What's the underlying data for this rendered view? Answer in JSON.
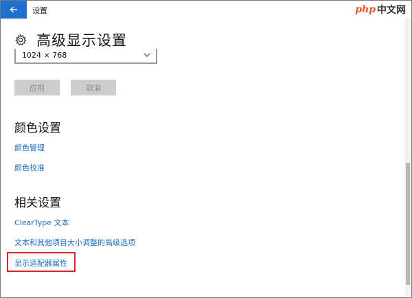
{
  "window": {
    "title": "设置",
    "watermark": {
      "brand": "php",
      "suffix": "中文网"
    }
  },
  "page": {
    "title": "高级显示设置",
    "resolution": {
      "value": "1024 × 768"
    },
    "buttons": {
      "apply": "应用",
      "cancel": "取消"
    }
  },
  "sections": {
    "color": {
      "heading": "颜色设置",
      "links": [
        "颜色管理",
        "颜色校准"
      ]
    },
    "related": {
      "heading": "相关设置",
      "links": [
        "ClearType 文本",
        "文本和其他项目大小调整的高级选项",
        "显示适配器属性"
      ]
    }
  },
  "icons": {
    "back": "arrow-left-icon",
    "settings": "gear-icon",
    "dropdown": "chevron-down-icon"
  },
  "colors": {
    "accent": "#1f6fd0",
    "link": "#1d6fc6",
    "highlight": "#d9252a"
  }
}
